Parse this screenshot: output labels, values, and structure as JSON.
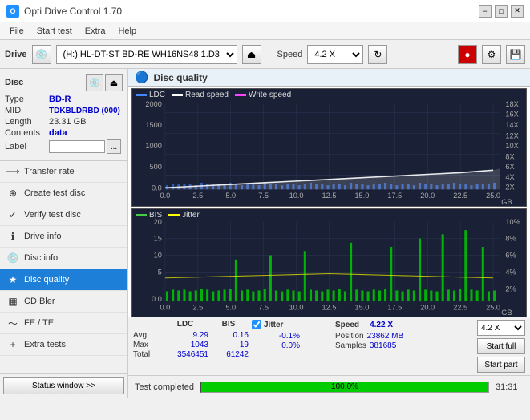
{
  "titleBar": {
    "icon": "O",
    "title": "Opti Drive Control 1.70",
    "minimize": "−",
    "maximize": "□",
    "close": "✕"
  },
  "menuBar": {
    "items": [
      "File",
      "Start test",
      "Extra",
      "Help"
    ]
  },
  "toolbar": {
    "driveLabel": "Drive",
    "driveValue": "(H:)  HL-DT-ST BD-RE  WH16NS48 1.D3",
    "speedLabel": "Speed",
    "speedValue": "4.2 X"
  },
  "sidebar": {
    "disc": {
      "title": "Disc",
      "typeLabel": "Type",
      "typeValue": "BD-R",
      "midLabel": "MID",
      "midValue": "TDKBLDRBD (000)",
      "lengthLabel": "Length",
      "lengthValue": "23.31 GB",
      "contentsLabel": "Contents",
      "contentsValue": "data",
      "labelLabel": "Label"
    },
    "items": [
      {
        "id": "transfer-rate",
        "label": "Transfer rate",
        "icon": "⟶"
      },
      {
        "id": "create-test-disc",
        "label": "Create test disc",
        "icon": "⊕"
      },
      {
        "id": "verify-test-disc",
        "label": "Verify test disc",
        "icon": "✓"
      },
      {
        "id": "drive-info",
        "label": "Drive info",
        "icon": "ℹ"
      },
      {
        "id": "disc-info",
        "label": "Disc info",
        "icon": "💿"
      },
      {
        "id": "disc-quality",
        "label": "Disc quality",
        "icon": "★",
        "active": true
      },
      {
        "id": "cd-bler",
        "label": "CD Bler",
        "icon": "▦"
      },
      {
        "id": "fe-te",
        "label": "FE / TE",
        "icon": "〜"
      },
      {
        "id": "extra-tests",
        "label": "Extra tests",
        "icon": "+"
      }
    ],
    "statusWindowBtn": "Status window >>"
  },
  "discQuality": {
    "title": "Disc quality",
    "legend": {
      "ldc": "LDC",
      "readSpeed": "Read speed",
      "writeSpeed": "Write speed"
    },
    "legend2": {
      "bis": "BIS",
      "jitter": "Jitter"
    },
    "chart1": {
      "yMax": 2000,
      "yLabels": [
        "2000",
        "1500",
        "1000",
        "500",
        "0.0"
      ],
      "xLabels": [
        "0.0",
        "2.5",
        "5.0",
        "7.5",
        "10.0",
        "12.5",
        "15.0",
        "17.5",
        "20.0",
        "22.5",
        "25.0"
      ],
      "yRightLabels": [
        "18X",
        "16X",
        "14X",
        "12X",
        "10X",
        "8X",
        "6X",
        "4X",
        "2X"
      ],
      "xAxisLabel": "GB"
    },
    "chart2": {
      "yMax": 20,
      "yLabels": [
        "20",
        "15",
        "10",
        "5",
        "0.0"
      ],
      "xLabels": [
        "0.0",
        "2.5",
        "5.0",
        "7.5",
        "10.0",
        "12.5",
        "15.0",
        "17.5",
        "20.0",
        "22.5",
        "25.0"
      ],
      "yRightLabels": [
        "10%",
        "8%",
        "6%",
        "4%",
        "2%"
      ],
      "xAxisLabel": "GB"
    },
    "stats": {
      "columns": [
        "LDC",
        "BIS",
        "",
        "Jitter",
        "Speed"
      ],
      "rows": [
        {
          "label": "Avg",
          "ldc": "9.29",
          "bis": "0.16",
          "jitter": "-0.1%",
          "speed": "4.22 X"
        },
        {
          "label": "Max",
          "ldc": "1043",
          "bis": "19",
          "jitter": "0.0%",
          "positionLabel": "Position",
          "position": "23862 MB"
        },
        {
          "label": "Total",
          "ldc": "3546451",
          "bis": "61242",
          "samples": "381685",
          "samplesLabel": "Samples"
        }
      ],
      "jitterChecked": true,
      "speedValue": "4.2 X",
      "startFull": "Start full",
      "startPart": "Start part"
    }
  },
  "bottomBar": {
    "statusWindowBtn": "Status window >>",
    "progressPercent": "100.0%",
    "progressValue": 100,
    "timeLabel": "31:31",
    "statusText": "Test completed"
  }
}
